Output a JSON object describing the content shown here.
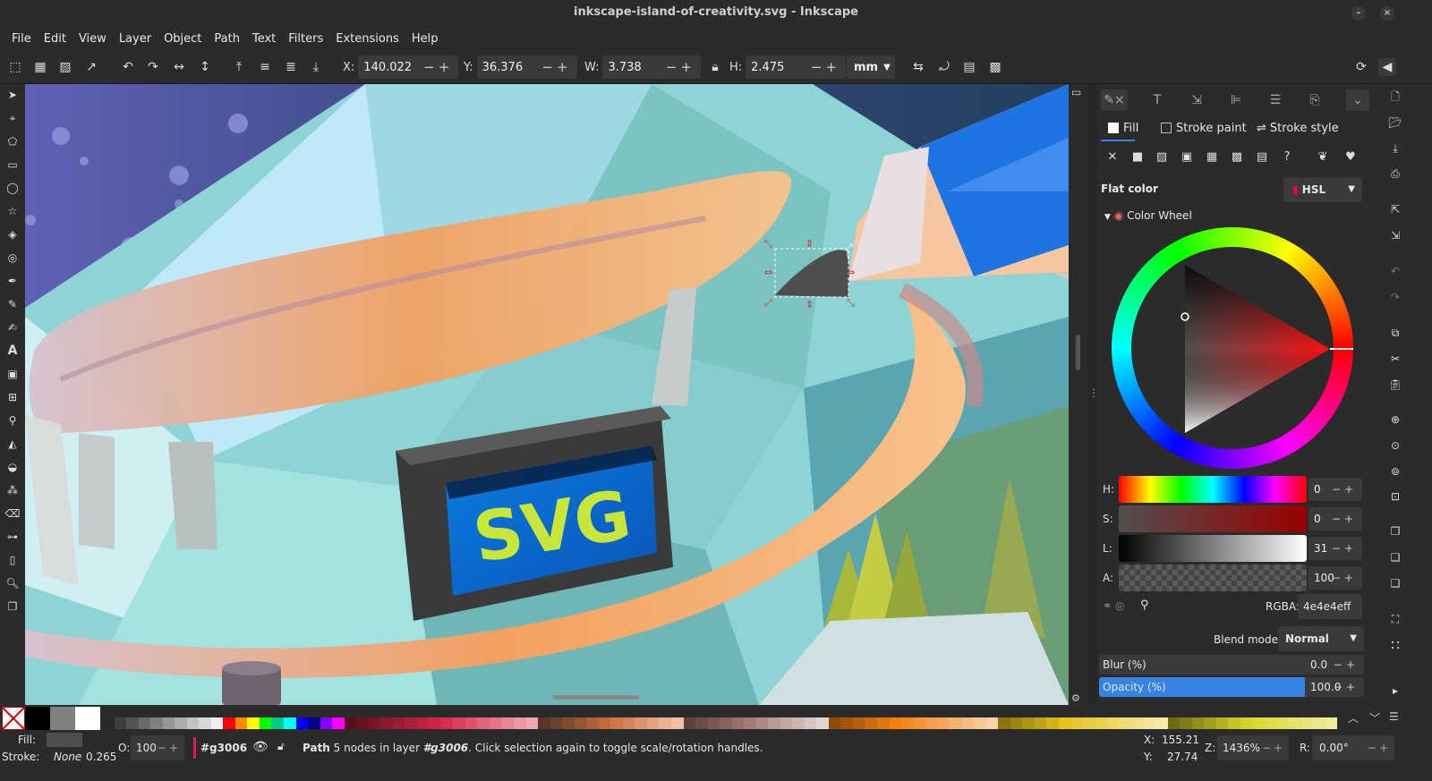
{
  "window": {
    "title": "inkscape-island-of-creativity.svg - Inkscape",
    "minimize": "–",
    "close": "×"
  },
  "menu": [
    "File",
    "Edit",
    "View",
    "Layer",
    "Object",
    "Path",
    "Text",
    "Filters",
    "Extensions",
    "Help"
  ],
  "toolbar": {
    "x_label": "X:",
    "x_value": "140.022",
    "y_label": "Y:",
    "y_value": "36.376",
    "w_label": "W:",
    "w_value": "3.738",
    "h_label": "H:",
    "h_value": "2.475",
    "unit": "mm",
    "stepper": "−+"
  },
  "artwork": {
    "sign_text": "SVG"
  },
  "panel": {
    "tab_fill": "Fill",
    "tab_stroke_paint": "Stroke paint",
    "tab_stroke_style": "Stroke style",
    "flat_color": "Flat color",
    "mode": "HSL",
    "wheel_label": "Color Wheel",
    "sliders": [
      {
        "label": "H:",
        "value": "0"
      },
      {
        "label": "S:",
        "value": "0"
      },
      {
        "label": "L:",
        "value": "31"
      },
      {
        "label": "A:",
        "value": "100"
      }
    ],
    "rgba_label": "RGBA:",
    "rgba_value": "4e4e4eff",
    "blend_label": "Blend mode:",
    "blend_value": "Normal",
    "blur_label": "Blur (%)",
    "blur_value": "0.0",
    "opacity_label": "Opacity (%)",
    "opacity_value": "100.0",
    "stepper": "−+"
  },
  "status": {
    "fill_label": "Fill:",
    "stroke_label": "Stroke:",
    "stroke_value": "None",
    "stroke_width": "0.265",
    "opacity_label": "O:",
    "opacity_value": "100",
    "layer": "#g3006",
    "message_bold": "Path",
    "message_mid": " 5 nodes in layer ",
    "message_layer": "#g3006",
    "message_end": ". Click selection again to toggle scale/rotation handles.",
    "cursor_x_label": "X:",
    "cursor_x": "155.21",
    "cursor_y_label": "Y:",
    "cursor_y": "27.74",
    "zoom_label": "Z:",
    "zoom": "1436%",
    "rotate_label": "R:",
    "rotate": "0.00°",
    "stepper": "−+"
  },
  "colors": {
    "accent": "#3584e4",
    "selected_fill": "#4e4e4e",
    "layer_marker": "#e01b4f"
  }
}
